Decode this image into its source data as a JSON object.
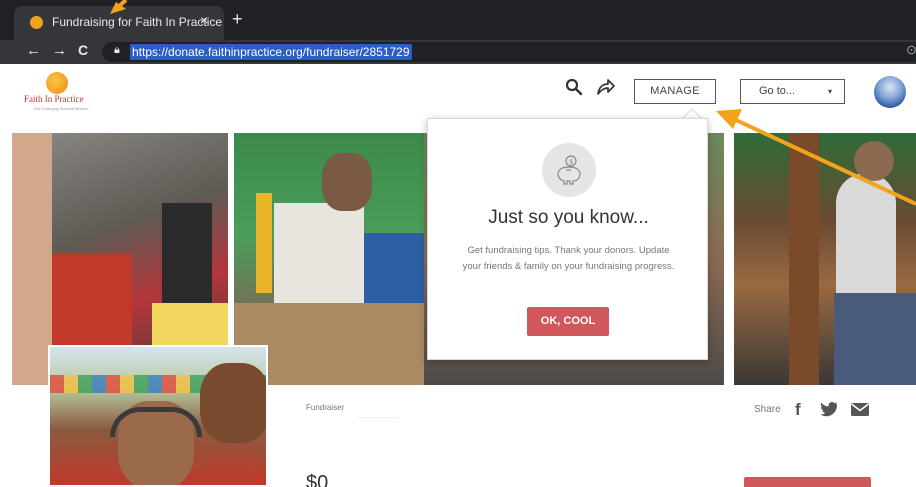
{
  "browser": {
    "tab_title": "Fundraising for Faith In Practice",
    "tab_close": "×",
    "new_tab": "+",
    "url": "https://donate.faithinpractice.org/fundraiser/2851729",
    "back": "←",
    "forward": "→",
    "reload": "C"
  },
  "site": {
    "logo_text": "Faith In Practice",
    "logo_tagline": "Life-Changing Medical Mission",
    "manage_label": "MANAGE",
    "goto_label": "Go to...",
    "goto_caret": "▾"
  },
  "popover": {
    "title": "Just so you know...",
    "body": "Get fundraising tips. Thank your donors. Update your friends & family on your fundraising progress.",
    "button_label": "OK, COOL"
  },
  "page": {
    "fundraiser_label": "Fundraiser",
    "share_label": "Share",
    "amount": "$0"
  },
  "colors": {
    "accent": "#d0575c",
    "annotation_arrow": "#f2a31b",
    "url_highlight": "#2c5cc5"
  },
  "icons": [
    "search-icon",
    "share-arrow-icon",
    "facebook-icon",
    "twitter-icon",
    "email-icon",
    "piggy-bank-icon",
    "lock-icon"
  ]
}
